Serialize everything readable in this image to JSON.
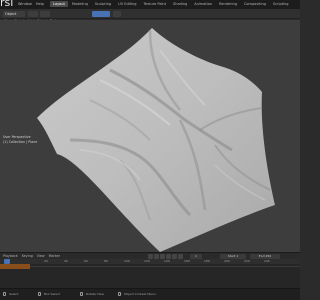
{
  "app": {
    "title": "rsi"
  },
  "menu": [
    "Window",
    "Help"
  ],
  "workspace_tabs": [
    "Layout",
    "Modeling",
    "Sculpting",
    "UV Editing",
    "Texture Paint",
    "Shading",
    "Animation",
    "Rendering",
    "Compositing",
    "Scripting"
  ],
  "header": {
    "mode": "Object",
    "menu": [
      "View",
      "Select",
      "Add",
      "Object",
      "Texture"
    ],
    "right": [
      "Global",
      "Normal",
      "Individual",
      "Snap",
      "Proportional"
    ]
  },
  "viewport": {
    "info_title": "User Perspective",
    "info_collection": "(1) Collection | Plane"
  },
  "timeline": {
    "menu": [
      "Playback",
      "Keying",
      "View",
      "Marker"
    ],
    "start_label": "Start",
    "start": "1",
    "end_label": "End",
    "end": "250",
    "current": "1",
    "ticks": [
      "20",
      "40",
      "60",
      "80",
      "100",
      "120",
      "140",
      "160",
      "180",
      "200",
      "220",
      "240"
    ]
  },
  "status": {
    "select": "Select",
    "box_select": "Box Select",
    "rotate": "Rotate View",
    "menu": "Object Context Menu"
  },
  "colors": {
    "accent": "#4772b3",
    "keyframe_track": "#8a4d1c",
    "viewport_bg": "#3d3d3d"
  }
}
